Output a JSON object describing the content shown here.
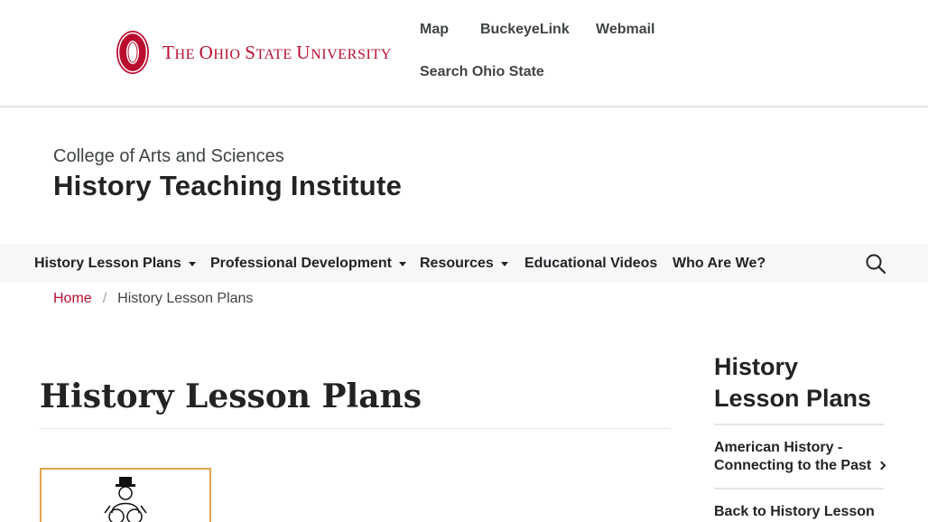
{
  "osu": {
    "wordmark": {
      "initial_1": "T",
      "rest_1": "HE ",
      "initial_2": "O",
      "rest_2": "HIO ",
      "initial_3": "S",
      "rest_3": "TATE ",
      "initial_4": "U",
      "rest_4": "NIVERSITY"
    },
    "links": [
      {
        "label": "Map"
      },
      {
        "label": "BuckeyeLink"
      },
      {
        "label": "Webmail"
      },
      {
        "label": "Search Ohio State"
      }
    ],
    "brand_color": "#ba0c2f"
  },
  "site": {
    "college": "College of Arts and Sciences",
    "title": "History Teaching Institute"
  },
  "nav": {
    "items": [
      {
        "label": "History Lesson Plans",
        "dropdown": true
      },
      {
        "label": "Professional Development",
        "dropdown": true
      },
      {
        "label": "Resources",
        "dropdown": true
      },
      {
        "label": "Educational Videos",
        "dropdown": false
      },
      {
        "label": "Who Are We?",
        "dropdown": false
      }
    ],
    "search_icon": "search-icon"
  },
  "breadcrumb": {
    "home": "Home",
    "separator": "/",
    "current": "History Lesson Plans"
  },
  "page": {
    "title": "History Lesson Plans"
  },
  "sidebar": {
    "title": "History Lesson Plans",
    "links": [
      {
        "label": "American History - Connecting to the Past"
      },
      {
        "label": "Back to History Lesson"
      }
    ]
  }
}
